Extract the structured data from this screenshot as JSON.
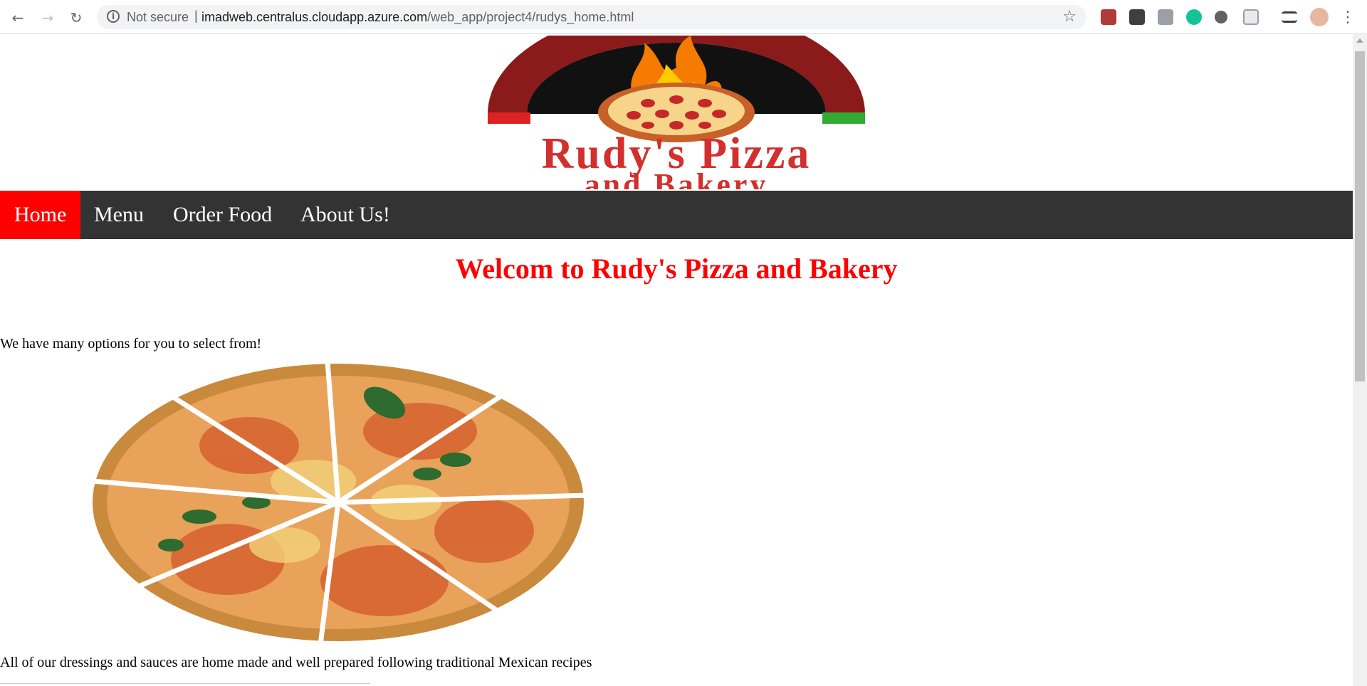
{
  "browser": {
    "security_label": "Not secure",
    "url_host": "imadweb.centralus.cloudapp.azure.com",
    "url_path": "/web_app/project4/rudys_home.html",
    "extensions": [
      "pdf-extension-icon",
      "lightbulb-extension-icon",
      "translate-extension-icon",
      "grammarly-icon",
      "circle-extension-icon",
      "cast-extension-icon",
      "media-queue-icon",
      "profile-avatar"
    ]
  },
  "logo": {
    "line1": "Rudy's Pizza",
    "line2": "and Bakery"
  },
  "nav": {
    "items": [
      {
        "label": "Home",
        "active": true
      },
      {
        "label": "Menu",
        "active": false
      },
      {
        "label": "Order Food",
        "active": false
      },
      {
        "label": "About Us!",
        "active": false
      }
    ]
  },
  "main": {
    "heading": "Welcom to Rudy's Pizza and Bakery",
    "intro": "We have many options for you to select from!",
    "dressings": "All of our dressings and sauces are home made and well prepared following traditional Mexican recipes"
  },
  "colors": {
    "accent": "#ff0000",
    "navbar": "#333333"
  }
}
